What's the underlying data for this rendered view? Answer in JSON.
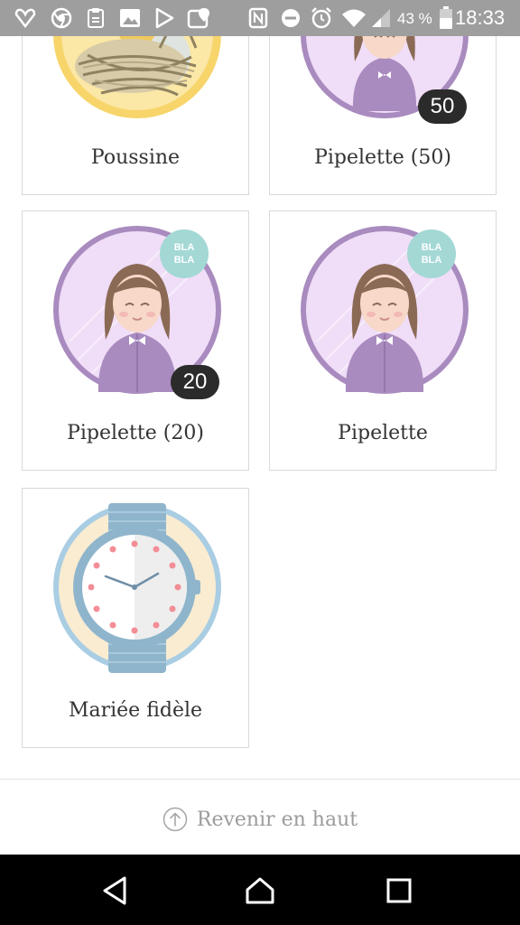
{
  "status_bar": {
    "battery": "43 %",
    "time": "18:33",
    "icons": [
      "vivino-icon",
      "chrome-icon",
      "clipboard-icon",
      "gallery-icon",
      "play-store-icon",
      "maps-icon",
      "nfc-icon",
      "dnd-icon",
      "alarm-icon",
      "wifi-icon",
      "signal-icon",
      "battery-icon"
    ]
  },
  "badges": [
    {
      "label": "Poussine"
    },
    {
      "label": "Pipelette (50)",
      "count": "50"
    },
    {
      "label": "Pipelette (20)",
      "count": "20",
      "bubble": "BLA BLA"
    },
    {
      "label": "Pipelette",
      "bubble": "BLA BLA"
    },
    {
      "label": "Mariée fidèle"
    }
  ],
  "footer": {
    "back_to_top": "Revenir en haut"
  },
  "colors": {
    "lavender": "#a98bbf",
    "lavender_bg": "#f0ddf7",
    "teal_bubble": "#a3d8d5",
    "nest_yellow": "#f7d56b",
    "watch_blue": "#8fb5cc",
    "watch_cream": "#f9ecd1",
    "count_badge": "#2b2b2b"
  }
}
